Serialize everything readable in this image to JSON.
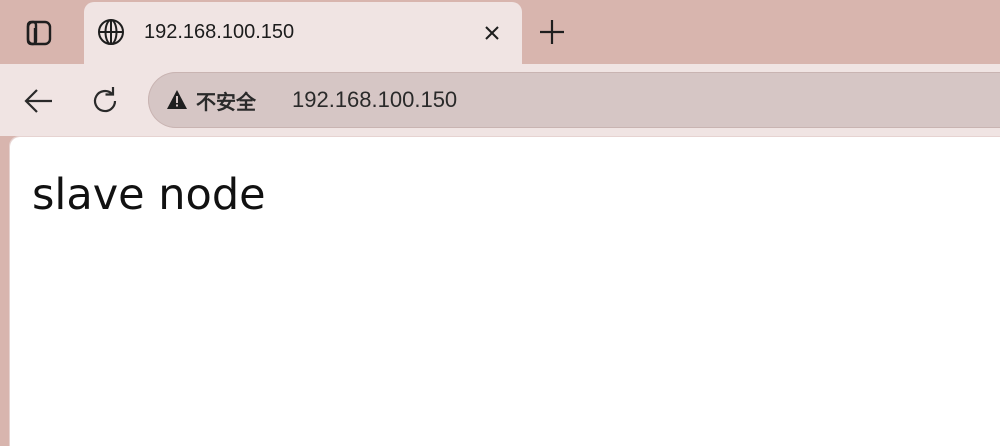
{
  "tab": {
    "title": "192.168.100.150",
    "close_glyph": "×",
    "favicon": "globe-icon"
  },
  "tabstrip": {
    "tab_actions_icon": "tab-actions-icon",
    "new_tab_icon": "plus-icon"
  },
  "toolbar": {
    "back_icon": "arrow-left-icon",
    "reload_icon": "reload-icon"
  },
  "omnibox": {
    "security_icon": "warning-triangle-icon",
    "security_label": "不安全",
    "url": "192.168.100.150"
  },
  "page": {
    "heading": "slave node"
  },
  "colors": {
    "tabstrip_bg": "#d8b5ae",
    "active_tab_bg": "#f0e4e3",
    "omnibox_bg": "#d6c6c5",
    "content_bg": "#ffffff"
  }
}
